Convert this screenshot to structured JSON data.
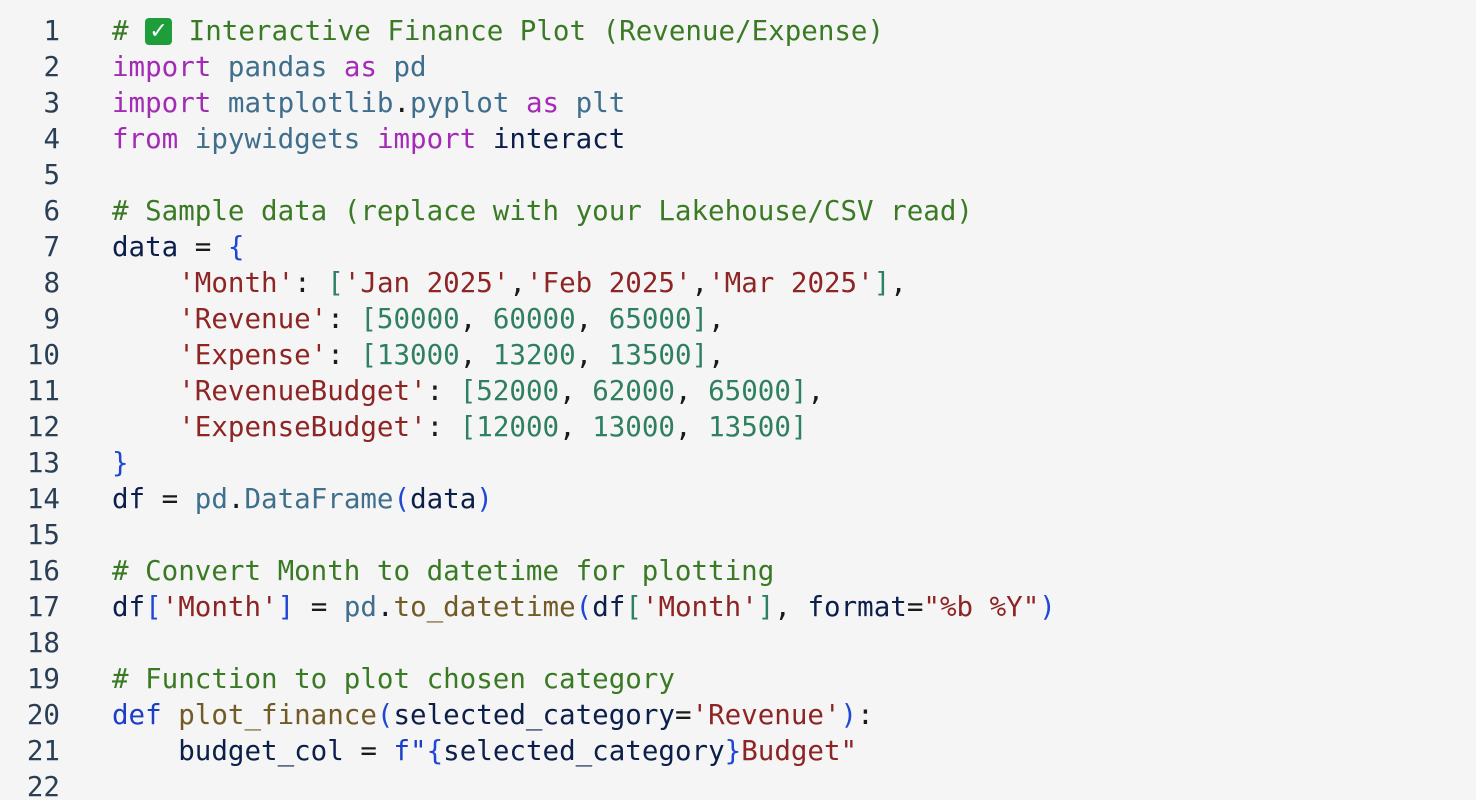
{
  "editor": {
    "line_numbers": [
      "1",
      "2",
      "3",
      "4",
      "5",
      "6",
      "7",
      "8",
      "9",
      "10",
      "11",
      "12",
      "13",
      "14",
      "15",
      "16",
      "17",
      "18",
      "19",
      "20",
      "21",
      "22"
    ],
    "lines": [
      [
        {
          "t": "# ",
          "c": "c-comment"
        },
        {
          "t": "✓",
          "c": "c-check",
          "icon": "check-mark-icon"
        },
        {
          "t": " Interactive Finance Plot (Revenue/Expense)",
          "c": "c-comment"
        }
      ],
      [
        {
          "t": "import",
          "c": "c-kw"
        },
        {
          "t": " ",
          "c": "c-punc"
        },
        {
          "t": "pandas",
          "c": "c-mod"
        },
        {
          "t": " ",
          "c": "c-punc"
        },
        {
          "t": "as",
          "c": "c-kw"
        },
        {
          "t": " ",
          "c": "c-punc"
        },
        {
          "t": "pd",
          "c": "c-mod"
        }
      ],
      [
        {
          "t": "import",
          "c": "c-kw"
        },
        {
          "t": " ",
          "c": "c-punc"
        },
        {
          "t": "matplotlib",
          "c": "c-mod"
        },
        {
          "t": ".",
          "c": "c-punc"
        },
        {
          "t": "pyplot",
          "c": "c-mod"
        },
        {
          "t": " ",
          "c": "c-punc"
        },
        {
          "t": "as",
          "c": "c-kw"
        },
        {
          "t": " ",
          "c": "c-punc"
        },
        {
          "t": "plt",
          "c": "c-mod"
        }
      ],
      [
        {
          "t": "from",
          "c": "c-kw"
        },
        {
          "t": " ",
          "c": "c-punc"
        },
        {
          "t": "ipywidgets",
          "c": "c-mod"
        },
        {
          "t": " ",
          "c": "c-punc"
        },
        {
          "t": "import",
          "c": "c-kw"
        },
        {
          "t": " ",
          "c": "c-punc"
        },
        {
          "t": "interact",
          "c": "c-ident"
        }
      ],
      [],
      [
        {
          "t": "# Sample data (replace with your Lakehouse/CSV read)",
          "c": "c-comment"
        }
      ],
      [
        {
          "t": "data",
          "c": "c-ident"
        },
        {
          "t": " = ",
          "c": "c-punc"
        },
        {
          "t": "{",
          "c": "c-brace"
        }
      ],
      [
        {
          "t": "    ",
          "c": "c-punc"
        },
        {
          "t": "'Month'",
          "c": "c-str"
        },
        {
          "t": ": ",
          "c": "c-punc"
        },
        {
          "t": "[",
          "c": "c-num"
        },
        {
          "t": "'Jan 2025'",
          "c": "c-str"
        },
        {
          "t": ",",
          "c": "c-punc"
        },
        {
          "t": "'Feb 2025'",
          "c": "c-str"
        },
        {
          "t": ",",
          "c": "c-punc"
        },
        {
          "t": "'Mar 2025'",
          "c": "c-str"
        },
        {
          "t": "]",
          "c": "c-num"
        },
        {
          "t": ",",
          "c": "c-punc"
        }
      ],
      [
        {
          "t": "    ",
          "c": "c-punc"
        },
        {
          "t": "'Revenue'",
          "c": "c-str"
        },
        {
          "t": ": ",
          "c": "c-punc"
        },
        {
          "t": "[50000",
          "c": "c-num"
        },
        {
          "t": ", ",
          "c": "c-punc"
        },
        {
          "t": "60000",
          "c": "c-num"
        },
        {
          "t": ", ",
          "c": "c-punc"
        },
        {
          "t": "65000]",
          "c": "c-num"
        },
        {
          "t": ",",
          "c": "c-punc"
        }
      ],
      [
        {
          "t": "    ",
          "c": "c-punc"
        },
        {
          "t": "'Expense'",
          "c": "c-str"
        },
        {
          "t": ": ",
          "c": "c-punc"
        },
        {
          "t": "[13000",
          "c": "c-num"
        },
        {
          "t": ", ",
          "c": "c-punc"
        },
        {
          "t": "13200",
          "c": "c-num"
        },
        {
          "t": ", ",
          "c": "c-punc"
        },
        {
          "t": "13500]",
          "c": "c-num"
        },
        {
          "t": ",",
          "c": "c-punc"
        }
      ],
      [
        {
          "t": "    ",
          "c": "c-punc"
        },
        {
          "t": "'RevenueBudget'",
          "c": "c-str"
        },
        {
          "t": ": ",
          "c": "c-punc"
        },
        {
          "t": "[52000",
          "c": "c-num"
        },
        {
          "t": ", ",
          "c": "c-punc"
        },
        {
          "t": "62000",
          "c": "c-num"
        },
        {
          "t": ", ",
          "c": "c-punc"
        },
        {
          "t": "65000]",
          "c": "c-num"
        },
        {
          "t": ",",
          "c": "c-punc"
        }
      ],
      [
        {
          "t": "    ",
          "c": "c-punc"
        },
        {
          "t": "'ExpenseBudget'",
          "c": "c-str"
        },
        {
          "t": ": ",
          "c": "c-punc"
        },
        {
          "t": "[12000",
          "c": "c-num"
        },
        {
          "t": ", ",
          "c": "c-punc"
        },
        {
          "t": "13000",
          "c": "c-num"
        },
        {
          "t": ", ",
          "c": "c-punc"
        },
        {
          "t": "13500]",
          "c": "c-num"
        }
      ],
      [
        {
          "t": "}",
          "c": "c-brace"
        }
      ],
      [
        {
          "t": "df",
          "c": "c-ident"
        },
        {
          "t": " = ",
          "c": "c-punc"
        },
        {
          "t": "pd",
          "c": "c-mod"
        },
        {
          "t": ".",
          "c": "c-punc"
        },
        {
          "t": "DataFrame",
          "c": "c-mod"
        },
        {
          "t": "(",
          "c": "c-brace"
        },
        {
          "t": "data",
          "c": "c-ident"
        },
        {
          "t": ")",
          "c": "c-brace"
        }
      ],
      [],
      [
        {
          "t": "# Convert Month to datetime for plotting",
          "c": "c-comment"
        }
      ],
      [
        {
          "t": "df",
          "c": "c-ident"
        },
        {
          "t": "[",
          "c": "c-brace"
        },
        {
          "t": "'Month'",
          "c": "c-str"
        },
        {
          "t": "]",
          "c": "c-brace"
        },
        {
          "t": " = ",
          "c": "c-punc"
        },
        {
          "t": "pd",
          "c": "c-mod"
        },
        {
          "t": ".",
          "c": "c-punc"
        },
        {
          "t": "to_datetime",
          "c": "c-func"
        },
        {
          "t": "(",
          "c": "c-brace"
        },
        {
          "t": "df",
          "c": "c-ident"
        },
        {
          "t": "[",
          "c": "c-num"
        },
        {
          "t": "'Month'",
          "c": "c-str"
        },
        {
          "t": "]",
          "c": "c-num"
        },
        {
          "t": ", ",
          "c": "c-punc"
        },
        {
          "t": "format",
          "c": "c-ident"
        },
        {
          "t": "=",
          "c": "c-punc"
        },
        {
          "t": "\"%b %Y\"",
          "c": "c-str"
        },
        {
          "t": ")",
          "c": "c-brace"
        }
      ],
      [],
      [
        {
          "t": "# Function to plot chosen category",
          "c": "c-comment"
        }
      ],
      [
        {
          "t": "def",
          "c": "c-def"
        },
        {
          "t": " ",
          "c": "c-punc"
        },
        {
          "t": "plot_finance",
          "c": "c-func"
        },
        {
          "t": "(",
          "c": "c-brace"
        },
        {
          "t": "selected_category",
          "c": "c-ident"
        },
        {
          "t": "=",
          "c": "c-punc"
        },
        {
          "t": "'Revenue'",
          "c": "c-str"
        },
        {
          "t": ")",
          "c": "c-brace"
        },
        {
          "t": ":",
          "c": "c-punc"
        }
      ],
      [
        {
          "t": "    ",
          "c": "c-punc"
        },
        {
          "t": "budget_col",
          "c": "c-ident"
        },
        {
          "t": " = ",
          "c": "c-punc"
        },
        {
          "t": "f\"",
          "c": "c-def"
        },
        {
          "t": "{",
          "c": "c-brace"
        },
        {
          "t": "selected_category",
          "c": "c-ident"
        },
        {
          "t": "}",
          "c": "c-brace"
        },
        {
          "t": "Budget\"",
          "c": "c-str"
        }
      ],
      []
    ]
  }
}
